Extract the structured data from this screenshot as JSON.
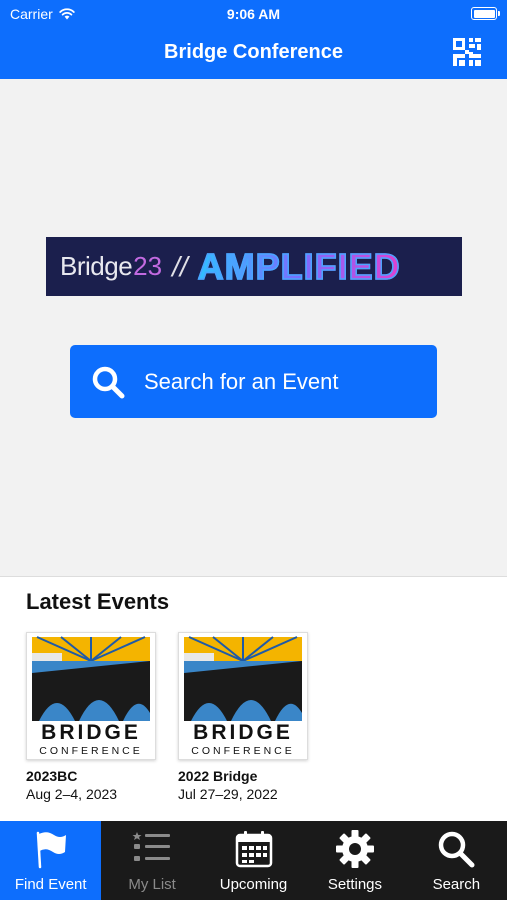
{
  "status": {
    "carrier": "Carrier",
    "time": "9:06 AM"
  },
  "nav": {
    "title": "Bridge Conference",
    "qr_icon": "qr-code-icon"
  },
  "banner": {
    "word": "Bridge",
    "number": "23",
    "slash": "//",
    "tagline": "AMPLIFIED"
  },
  "search_button": {
    "label": "Search for an Event",
    "icon": "search-icon"
  },
  "latest": {
    "heading": "Latest Events",
    "events": [
      {
        "name": "2023BC",
        "date": "Aug 2–4, 2023",
        "logo_top": "BRIDGE",
        "logo_bottom": "CONFERENCE"
      },
      {
        "name": "2022 Bridge",
        "date": "Jul 27–29, 2022",
        "logo_top": "BRIDGE",
        "logo_bottom": "CONFERENCE"
      }
    ]
  },
  "tabs": [
    {
      "label": "Find Event",
      "icon": "flag-icon",
      "active": true
    },
    {
      "label": "My List",
      "icon": "list-icon",
      "dimmed": true
    },
    {
      "label": "Upcoming",
      "icon": "calendar-icon"
    },
    {
      "label": "Settings",
      "icon": "gear-icon"
    },
    {
      "label": "Search",
      "icon": "search-icon"
    }
  ],
  "colors": {
    "brand_blue": "#0d6efd",
    "tab_bar": "#1a1a1a",
    "banner_bg": "#1b1f4d"
  }
}
